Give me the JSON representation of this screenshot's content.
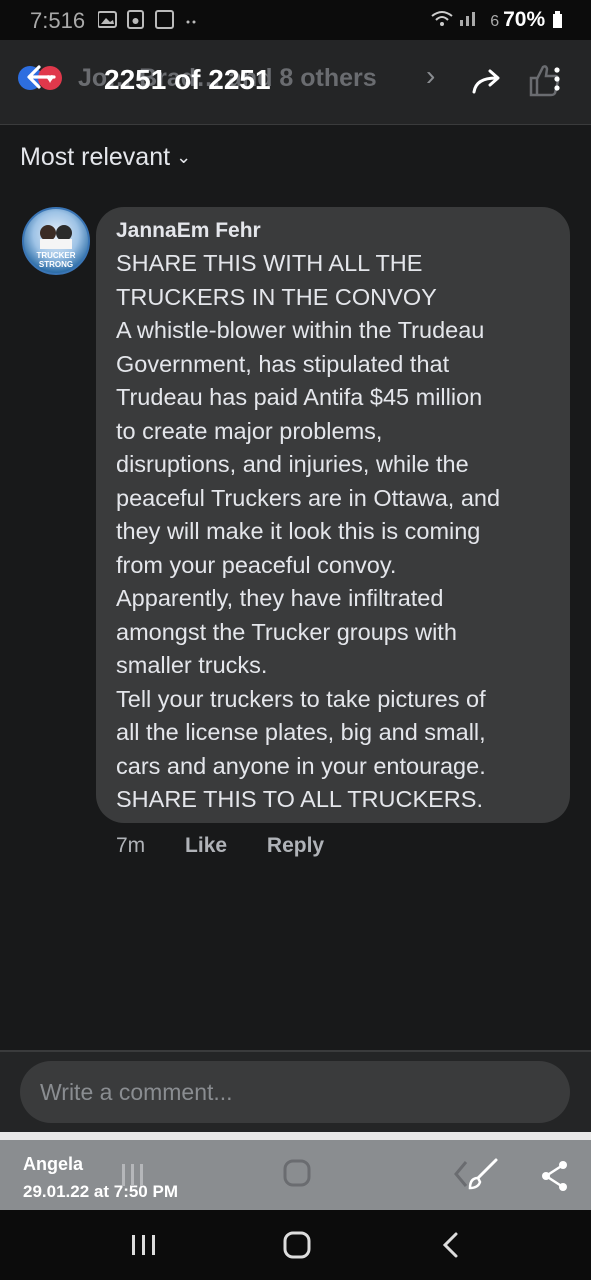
{
  "status_bar": {
    "time": "7:51",
    "time_suffix": "6",
    "battery": "70%",
    "signal_text": "6"
  },
  "header": {
    "behind_text": "Jo… Brad… and 8 others",
    "counter": "2251 of 2251"
  },
  "sort": {
    "label": "Most relevant"
  },
  "comment": {
    "avatar_label": "TRUCKER STRONG",
    "author": "JannaEm Fehr",
    "lines": [
      "SHARE THIS WITH ALL THE",
      "TRUCKERS IN THE CONVOY",
      "A whistle-blower within the Trudeau",
      "Government, has stipulated that",
      "Trudeau has paid Antifa $45 million",
      "to create major problems,",
      "disruptions, and injuries, while the",
      "peaceful Truckers are in Ottawa, and",
      "they will make it look this is coming",
      "from your peaceful convoy.",
      "Apparently, they have infiltrated",
      "amongst the Trucker groups with",
      "smaller trucks.",
      "Tell your truckers to take pictures of",
      "all the license plates, big and small,",
      "cars and anyone in your entourage.",
      "SHARE THIS TO ALL TRUCKERS."
    ],
    "time": "7m",
    "like_label": "Like",
    "reply_label": "Reply"
  },
  "composer": {
    "placeholder": "Write a comment..."
  },
  "overlay": {
    "name": "Angela",
    "date": "29.01.22 at 7:50 PM"
  }
}
